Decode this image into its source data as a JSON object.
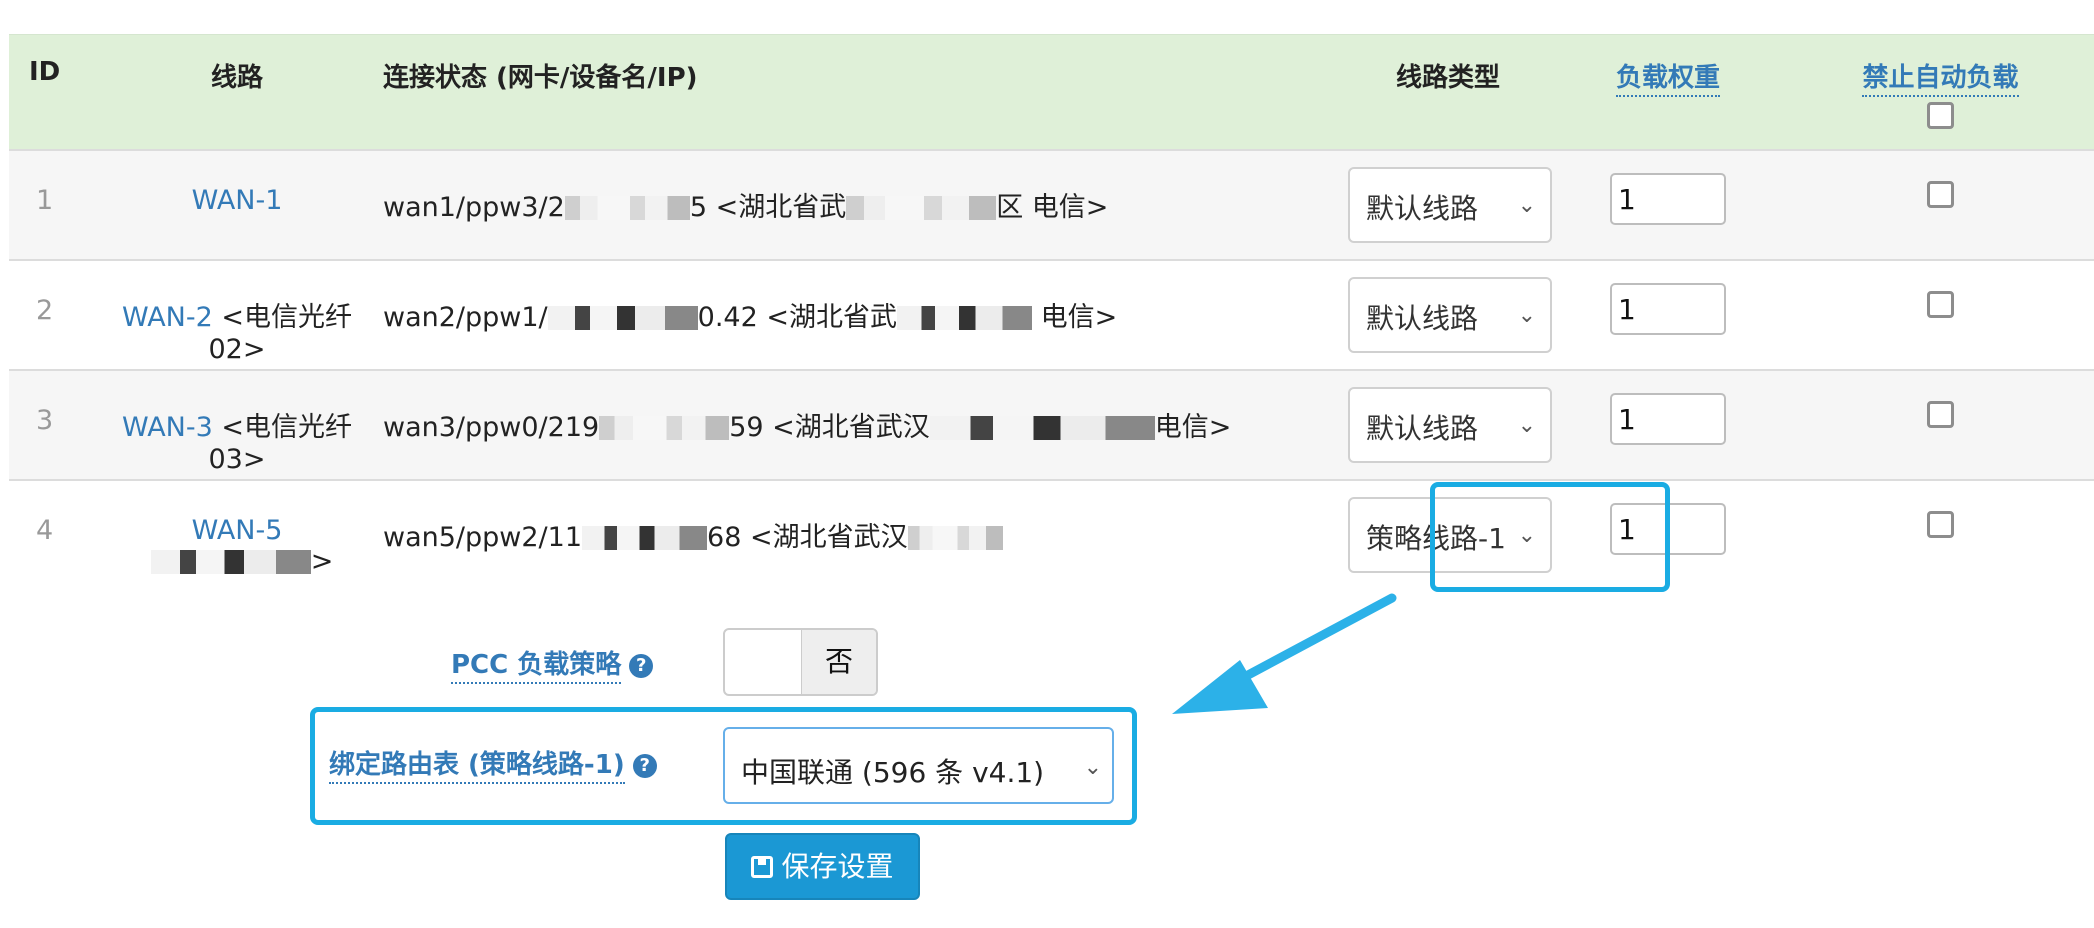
{
  "table": {
    "headers": {
      "id": "ID",
      "line": "线路",
      "status": "连接状态 (网卡/设备名/IP)",
      "type": "线路类型",
      "weight": "负载权重",
      "disable": "禁止自动负载"
    },
    "rows": [
      {
        "id": "1",
        "name": "WAN-1",
        "alias": "",
        "status_a": "wan1/ppw3/2",
        "status_b": "5  <湖北省武",
        "status_c": "区 电信>",
        "type": "默认线路",
        "weight": "1"
      },
      {
        "id": "2",
        "name": "WAN-2",
        "alias": " <电信光纤02>",
        "status_a": "wan2/ppw1/",
        "status_b": "0.42  <湖北省武",
        "status_c": " 电信>",
        "type": "默认线路",
        "weight": "1"
      },
      {
        "id": "3",
        "name": "WAN-3",
        "alias": " <电信光纤03>",
        "status_a": "wan3/ppw0/219",
        "status_b": "59  <湖北省武汉",
        "status_c": "电信>",
        "type": "默认线路",
        "weight": "1"
      },
      {
        "id": "4",
        "name": "WAN-5",
        "alias": ">",
        "status_a": "wan5/ppw2/11",
        "status_b": "68  <湖北省武汉",
        "status_c": "",
        "type": "策略线路-1",
        "weight": "1"
      }
    ]
  },
  "form": {
    "pcc_label": "PCC 负载策略",
    "pcc_value": "否",
    "bind_label": "绑定路由表 (策略线路-1)",
    "bind_value": "中国联通 (596 条 v4.1)",
    "save_label": "保存设置"
  },
  "colors": {
    "header_bg": "#dff0d8",
    "link": "#337ab7",
    "highlight": "#1aace3",
    "save_button": "#1b98d4"
  }
}
